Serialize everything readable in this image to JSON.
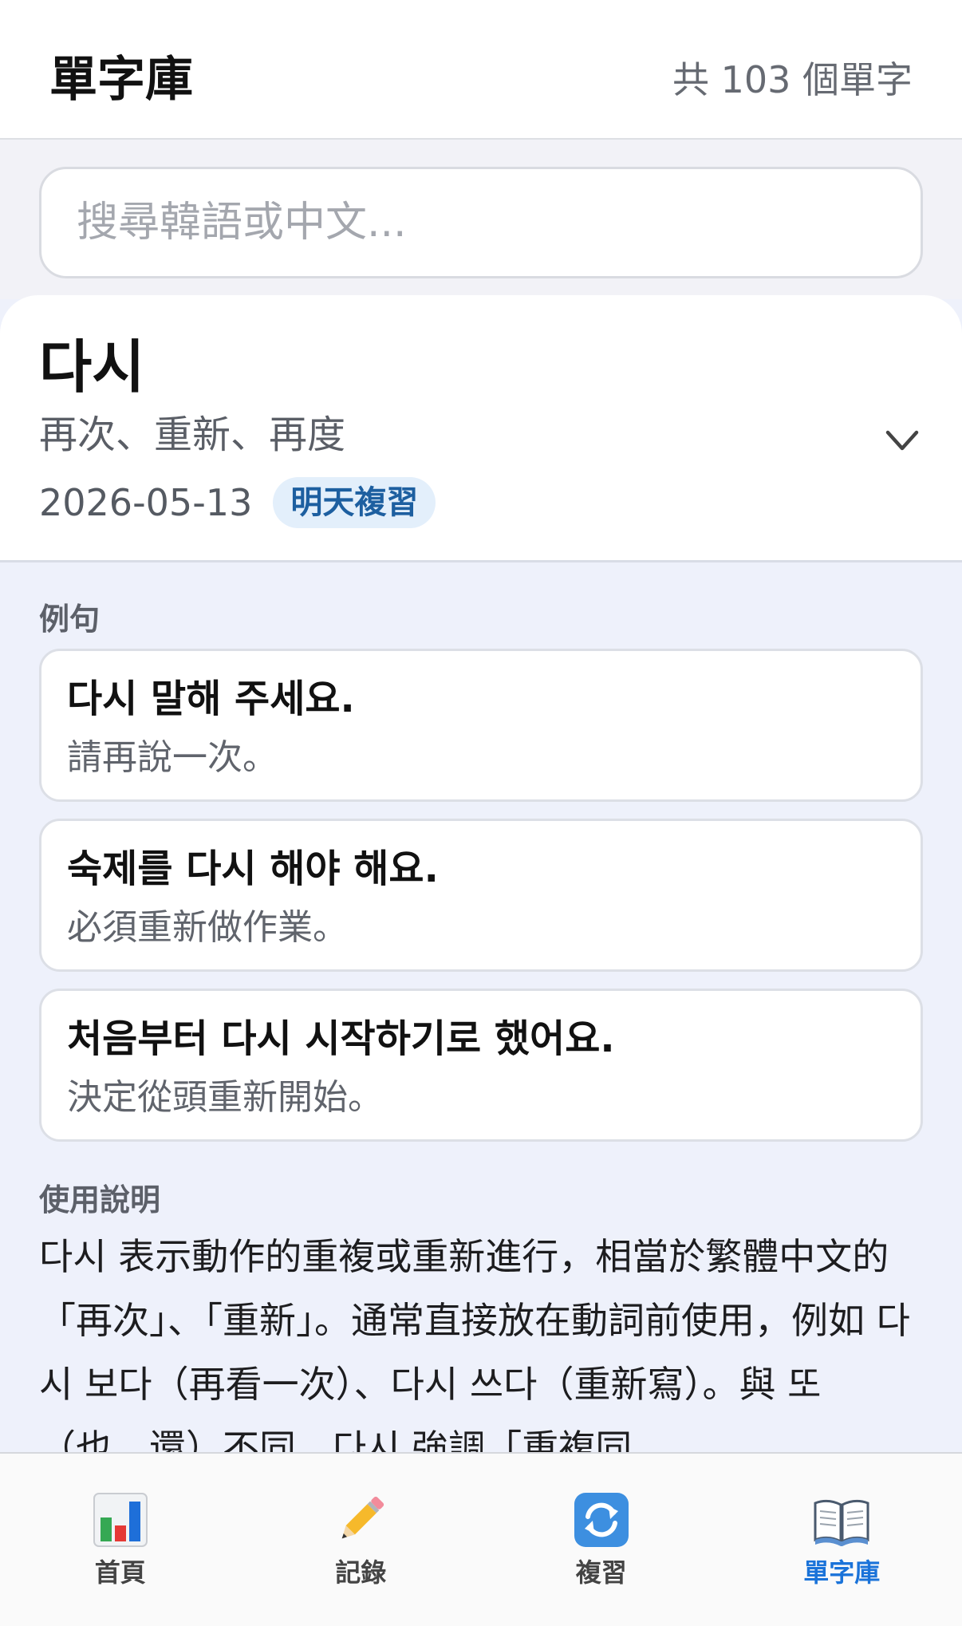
{
  "header": {
    "title": "單字庫",
    "count_text": "共 103 個單字"
  },
  "search": {
    "placeholder": "搜尋韓語或中文..."
  },
  "word": {
    "korean": "다시",
    "meaning": "再次、重新、再度",
    "date": "2026-05-13",
    "review_badge": "明天複習",
    "expand_icon": "chevron-down-icon"
  },
  "examples_section": {
    "title": "例句",
    "items": [
      {
        "korean": "다시 말해 주세요.",
        "chinese": "請再說一次。"
      },
      {
        "korean": "숙제를 다시 해야 해요.",
        "chinese": "必須重新做作業。"
      },
      {
        "korean": "처음부터 다시 시작하기로 했어요.",
        "chinese": "決定從頭重新開始。"
      }
    ]
  },
  "usage_section": {
    "title": "使用說明",
    "text": "다시 表示動作的重複或重新進行，相當於繁體中文的「再次」、「重新」。通常直接放在動詞前使用，例如 다시 보다（再看一次）、다시 쓰다（重新寫）。與 또（也、還）不同，다시 強調「重複同"
  },
  "tabbar": {
    "active": "vocab",
    "tabs": [
      {
        "id": "home",
        "label": "首頁",
        "icon": "bar-chart-icon"
      },
      {
        "id": "records",
        "label": "記錄",
        "icon": "pencil-icon"
      },
      {
        "id": "review",
        "label": "複習",
        "icon": "refresh-icon"
      },
      {
        "id": "vocab",
        "label": "單字庫",
        "icon": "open-book-icon"
      }
    ]
  },
  "colors": {
    "accent": "#1a73d9",
    "badge_bg": "#e3effb",
    "badge_text": "#1d5fa0",
    "detail_bg": "#eef1fb"
  }
}
